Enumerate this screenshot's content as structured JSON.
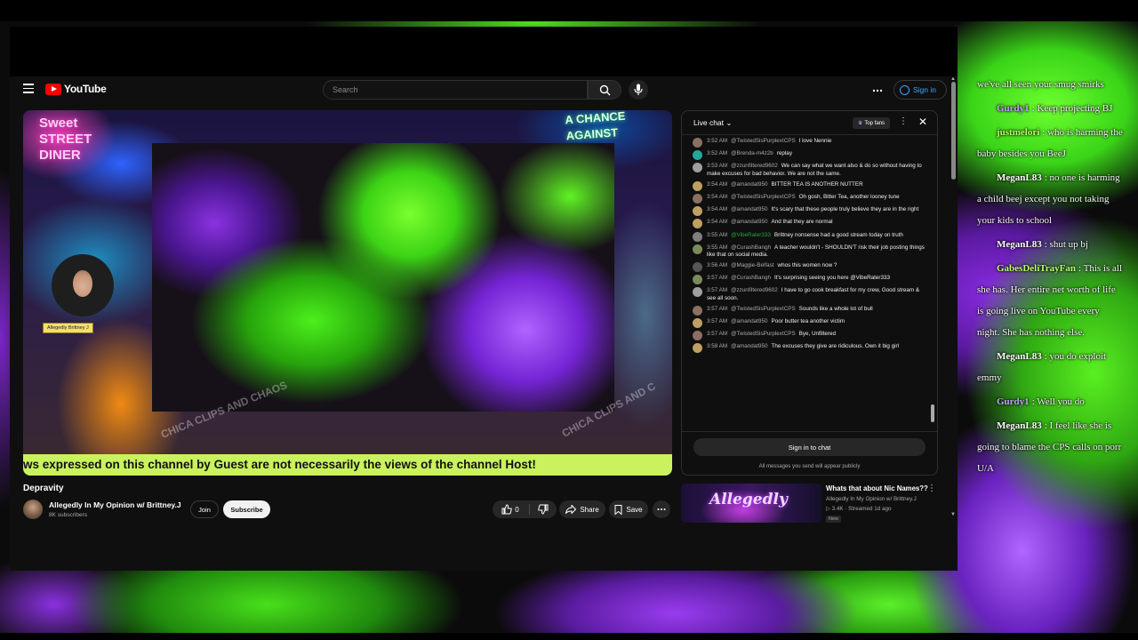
{
  "masthead": {
    "logo": "YouTube",
    "search_placeholder": "Search",
    "signin": "Sign in"
  },
  "player": {
    "sign_left": "Sweet\nSTREET\nDINER",
    "sign_right": "A CHANCE\nAGAINST",
    "name_tag": "Allegedly Brittney J",
    "watermark_1": "CHICA CLIPS AND CHAOS",
    "watermark_2": "CHICA CLIPS AND C",
    "ticker": "ws expressed on this channel by Guest are not necessarily the views of the channel Host!"
  },
  "video": {
    "title": "Depravity",
    "channel": "Allegedly In My Opinion w/ Brittney.J",
    "subscribers": "8K subscribers",
    "join": "Join",
    "subscribe": "Subscribe",
    "likes": "0",
    "share": "Share",
    "save": "Save"
  },
  "chat": {
    "title": "Live chat",
    "top_fans": "Top fans",
    "signin": "Sign in to chat",
    "note": "All messages you send will appear publicly",
    "messages": [
      {
        "time": "3:52 AM",
        "author": "@TwistedSisPurplextCPS",
        "text": "I love Nennie",
        "color": "#8d6e63"
      },
      {
        "time": "3:52 AM",
        "author": "@Brenda-m4z2b",
        "text": "replay",
        "color": "#26a69a"
      },
      {
        "time": "3:53 AM",
        "author": "@zzunfiltered9602",
        "text": "We can say what we want also & do so without having to make excuses for bad behavior. We are not the same.",
        "color": "#9e9e9e"
      },
      {
        "time": "3:54 AM",
        "author": "@amandat950",
        "text": "BITTER TEA IS ANOTHER NUTTER",
        "color": "#c0a060"
      },
      {
        "time": "3:54 AM",
        "author": "@TwistedSisPurplextCPS",
        "text": "Oh gosh, Bitter Tea, another looney tune",
        "color": "#8d6e63"
      },
      {
        "time": "3:54 AM",
        "author": "@amandat950",
        "text": "It's scary that these people truly believe they are in the right",
        "color": "#c0a060"
      },
      {
        "time": "3:54 AM",
        "author": "@amandat950",
        "text": "And that they are normal",
        "color": "#c0a060"
      },
      {
        "time": "3:55 AM",
        "author": "@VibeRater333",
        "text": "Brittney nonsense had a good stream today on truth",
        "color": "#7e7e7e"
      },
      {
        "time": "3:55 AM",
        "author": "@CurashBangh",
        "text": "A teacher wouldn't - SHOULDN'T risk their job posting things like that on social media.",
        "color": "#7a8a5a"
      },
      {
        "time": "3:56 AM",
        "author": "@Maggie-Belfast",
        "text": "whos this women now ?",
        "color": "#555555"
      },
      {
        "time": "3:57 AM",
        "author": "@CurashBangh",
        "text": "It's surprising seeing you here @VibeRater333",
        "color": "#7a8a5a"
      },
      {
        "time": "3:57 AM",
        "author": "@zzunfiltered9602",
        "text": "I have to go cook breakfast for my crew, Good stream & see all soon.",
        "color": "#9e9e9e"
      },
      {
        "time": "3:57 AM",
        "author": "@TwistedSisPurplextCPS",
        "text": "Sounds like a whole lot of bull",
        "color": "#8d6e63"
      },
      {
        "time": "3:57 AM",
        "author": "@amandat950",
        "text": "Poor butter tea another victim",
        "color": "#c0a060"
      },
      {
        "time": "3:57 AM",
        "author": "@TwistedSisPurplextCPS",
        "text": "Bye, Unfiltered",
        "color": "#8d6e63"
      },
      {
        "time": "3:58 AM",
        "author": "@amandat950",
        "text": "The excuses they give are ridiculous. Own it big girl",
        "color": "#c0a060"
      }
    ]
  },
  "recommended": {
    "thumb_text": "Allegedly",
    "title": "Whats that about Nic Names??",
    "channel": "Allegedly In My Opinion w/ Brittney.J",
    "meta": "3.4K · Streamed 1d ago",
    "badge": "New"
  },
  "overlay_chat": [
    {
      "user": "",
      "text": "we've all seen your smug smirks",
      "user_color": "#ffffff"
    },
    {
      "user": "Gurdy1",
      "text": ": Keep projecting BJ",
      "user_color": "#c7a0ff"
    },
    {
      "user": "justmelori",
      "text": ": who is harming the baby besides you BeeJ",
      "user_color": "#b8ff6a"
    },
    {
      "user": "MeganL83",
      "text": ": no one is harming a child beej except you not taking your kids to school",
      "user_color": "#ffffff"
    },
    {
      "user": "MeganL83",
      "text": ": shut up bj",
      "user_color": "#ffffff"
    },
    {
      "user": "GabesDeliTrayFan",
      "text": ": This is all she has. Her entire net worth of life is going live on YouTube every night. She has nothing else.",
      "user_color": "#b8ff6a"
    },
    {
      "user": "MeganL83",
      "text": ": you do exploit emmy",
      "user_color": "#ffffff"
    },
    {
      "user": "Gurdy1",
      "text": ": Well you do",
      "user_color": "#c7a0ff"
    },
    {
      "user": "MeganL83",
      "text": ": I feel like she is going to blame the CPS calls on porr U/A",
      "user_color": "#ffffff"
    }
  ]
}
